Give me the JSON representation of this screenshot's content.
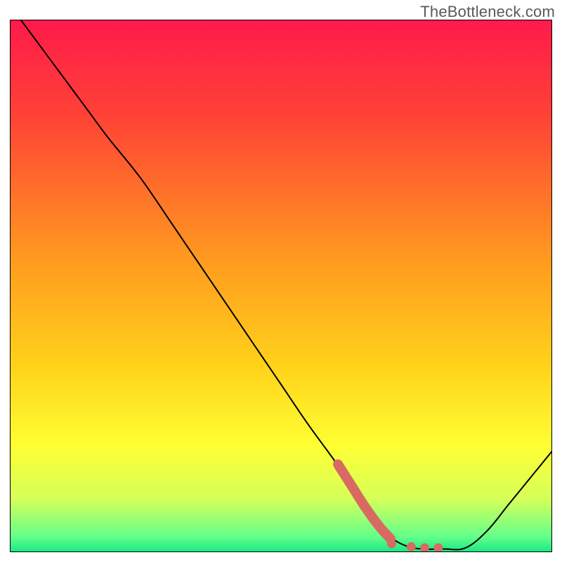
{
  "watermark": "TheBottleneck.com",
  "chart_data": {
    "type": "line",
    "title": "",
    "xlabel": "",
    "ylabel": "",
    "xlim": [
      0,
      100
    ],
    "ylim": [
      0,
      100
    ],
    "grid": false,
    "legend": false,
    "gradient_stops": [
      {
        "offset": 0.0,
        "color": "#ff1a4b"
      },
      {
        "offset": 0.18,
        "color": "#ff4236"
      },
      {
        "offset": 0.45,
        "color": "#ff9a1f"
      },
      {
        "offset": 0.65,
        "color": "#ffd21a"
      },
      {
        "offset": 0.8,
        "color": "#ffff33"
      },
      {
        "offset": 0.9,
        "color": "#d5ff59"
      },
      {
        "offset": 0.97,
        "color": "#66ff8a"
      },
      {
        "offset": 1.0,
        "color": "#18e884"
      }
    ],
    "series": [
      {
        "name": "curve",
        "style": "thin-black",
        "points": [
          {
            "x": 2.0,
            "y": 100.0
          },
          {
            "x": 6.0,
            "y": 94.5
          },
          {
            "x": 10.0,
            "y": 89.0
          },
          {
            "x": 14.0,
            "y": 83.5
          },
          {
            "x": 18.0,
            "y": 78.0
          },
          {
            "x": 22.0,
            "y": 73.0
          },
          {
            "x": 25.0,
            "y": 69.0
          },
          {
            "x": 30.0,
            "y": 61.5
          },
          {
            "x": 35.0,
            "y": 54.0
          },
          {
            "x": 40.0,
            "y": 46.5
          },
          {
            "x": 45.0,
            "y": 39.0
          },
          {
            "x": 50.0,
            "y": 31.5
          },
          {
            "x": 55.0,
            "y": 24.0
          },
          {
            "x": 60.0,
            "y": 17.0
          },
          {
            "x": 64.0,
            "y": 11.0
          },
          {
            "x": 67.0,
            "y": 6.5
          },
          {
            "x": 70.0,
            "y": 3.0
          },
          {
            "x": 73.0,
            "y": 1.2
          },
          {
            "x": 76.0,
            "y": 0.6
          },
          {
            "x": 80.0,
            "y": 0.6
          },
          {
            "x": 84.0,
            "y": 0.8
          },
          {
            "x": 88.0,
            "y": 4.0
          },
          {
            "x": 92.0,
            "y": 9.0
          },
          {
            "x": 96.0,
            "y": 14.0
          },
          {
            "x": 100.0,
            "y": 19.0
          }
        ]
      },
      {
        "name": "highlight-steep",
        "style": "thick-red",
        "points": [
          {
            "x": 60.5,
            "y": 16.5
          },
          {
            "x": 63.0,
            "y": 12.5
          },
          {
            "x": 65.5,
            "y": 8.5
          },
          {
            "x": 68.0,
            "y": 5.0
          },
          {
            "x": 70.2,
            "y": 2.5
          }
        ]
      }
    ],
    "highlight_dots": {
      "style": "red-dot",
      "points": [
        {
          "x": 70.4,
          "y": 1.6
        },
        {
          "x": 74.0,
          "y": 1.0
        },
        {
          "x": 76.5,
          "y": 0.8
        },
        {
          "x": 79.0,
          "y": 0.8
        }
      ]
    }
  }
}
